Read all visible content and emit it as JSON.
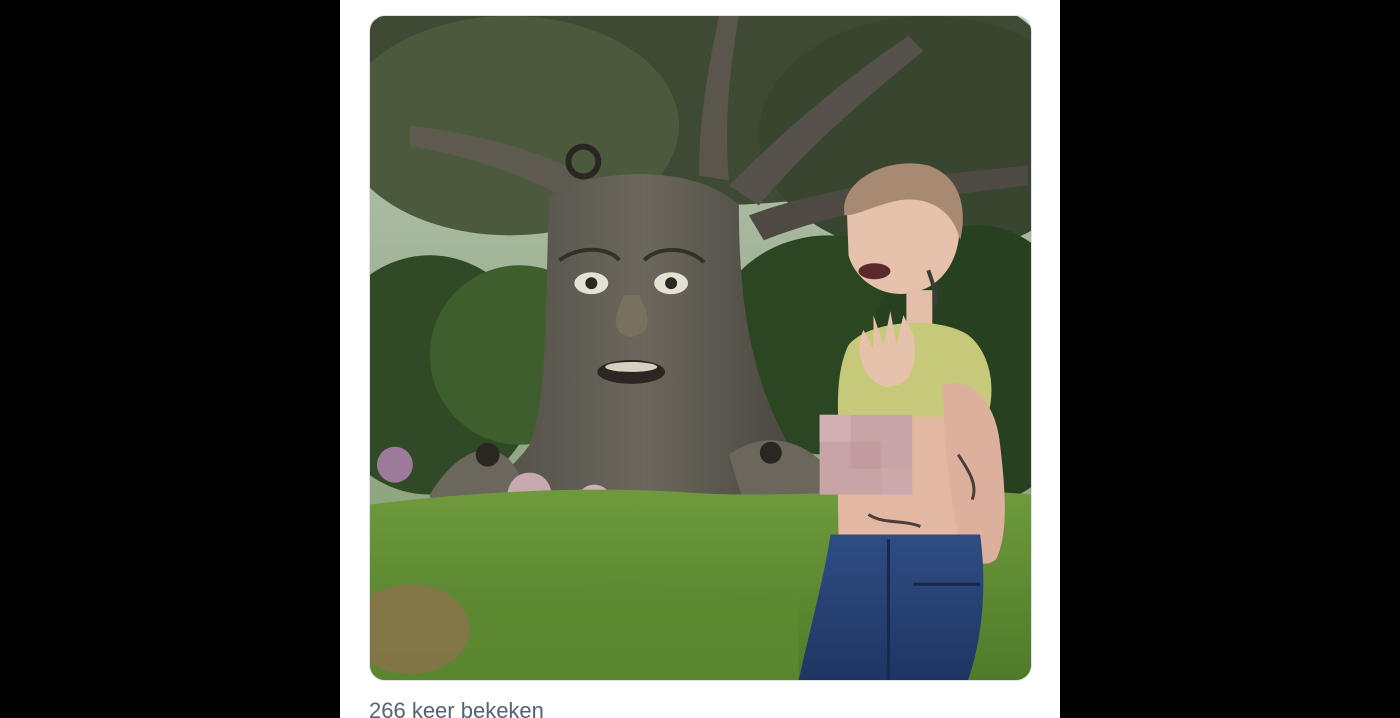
{
  "post": {
    "view_count_text": "266 keer bekeken"
  },
  "media": {
    "type": "video-frame",
    "description_icon": "video-thumbnail",
    "censored_region": true
  },
  "colors": {
    "page_background": "#000000",
    "card_background": "#ffffff",
    "meta_text": "#536471",
    "censor_block": "#c9a4a6"
  }
}
